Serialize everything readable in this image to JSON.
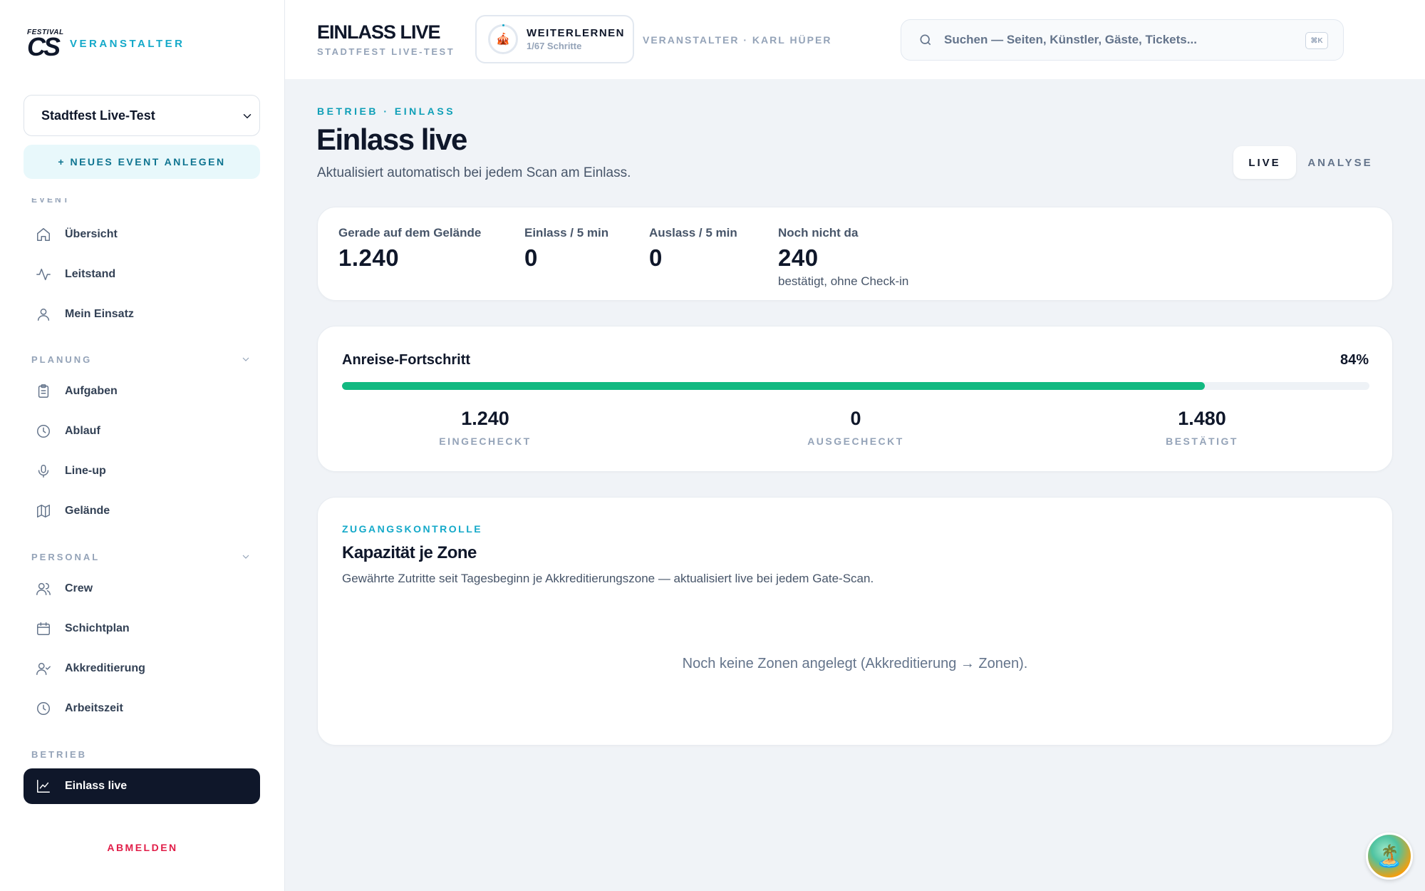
{
  "brand": {
    "logo_small": "FESTIVAL",
    "logo_big": "CS",
    "label": "VERANSTALTER"
  },
  "sidebar": {
    "event_select": "Stadtfest Live-Test",
    "new_event": "+ NEUES EVENT ANLEGEN",
    "cut_section": "EVENT",
    "items_event": [
      {
        "label": "Übersicht",
        "icon": "home-icon"
      },
      {
        "label": "Leitstand",
        "icon": "activity-icon"
      },
      {
        "label": "Mein Einsatz",
        "icon": "user-icon"
      }
    ],
    "section_planung": "PLANUNG",
    "items_planung": [
      {
        "label": "Aufgaben",
        "icon": "clipboard-icon"
      },
      {
        "label": "Ablauf",
        "icon": "clock-icon"
      },
      {
        "label": "Line-up",
        "icon": "microphone-icon"
      },
      {
        "label": "Gelände",
        "icon": "map-icon"
      }
    ],
    "section_personal": "PERSONAL",
    "items_personal": [
      {
        "label": "Crew",
        "icon": "users-icon"
      },
      {
        "label": "Schichtplan",
        "icon": "calendar-icon"
      },
      {
        "label": "Akkreditierung",
        "icon": "user-check-icon"
      },
      {
        "label": "Arbeitszeit",
        "icon": "clock-icon"
      }
    ],
    "section_betrieb": "BETRIEB",
    "items_betrieb": [
      {
        "label": "Einlass live",
        "icon": "chart-line-icon",
        "active": true
      }
    ],
    "logout": "ABMELDEN"
  },
  "header": {
    "title": "EINLASS LIVE",
    "subtitle": "STADTFEST LIVE-TEST",
    "learn_title": "WEITERLERNEN",
    "learn_progress": "1/67 Schritte",
    "user": "VERANSTALTER · KARL HÜPER",
    "search_placeholder": "Suchen — Seiten, Künstler, Gäste, Tickets...",
    "search_shortcut": "⌘K"
  },
  "main": {
    "breadcrumb": "BETRIEB · EINLASS",
    "title": "Einlass live",
    "subtitle": "Aktualisiert automatisch bei jedem Scan am Einlass.",
    "tabs": {
      "live": "LIVE",
      "analyse": "ANALYSE"
    },
    "kpis": [
      {
        "label": "Gerade auf dem Gelände",
        "value": "1.240"
      },
      {
        "label": "Einlass / 5 min",
        "value": "0"
      },
      {
        "label": "Auslass / 5 min",
        "value": "0"
      },
      {
        "label": "Noch nicht da",
        "value": "240",
        "note": "bestätigt, ohne Check-in"
      }
    ],
    "progress": {
      "title": "Anreise-Fortschritt",
      "percent_label": "84%",
      "fraction": 0.84,
      "stats": [
        {
          "value": "1.240",
          "label": "EINGECHECKT"
        },
        {
          "value": "0",
          "label": "AUSGECHECKT"
        },
        {
          "value": "1.480",
          "label": "BESTÄTIGT"
        }
      ]
    },
    "zones": {
      "eyebrow": "ZUGANGSKONTROLLE",
      "title": "Kapazität je Zone",
      "description": "Gewährte Zutritte seit Tagesbeginn je Akkreditierungszone — aktualisiert live bei jedem Gate-Scan.",
      "empty": "Noch keine Zonen angelegt (Akkreditierung → Zonen)."
    }
  },
  "colors": {
    "accent": "#14a9c9",
    "progress": "#12b981",
    "active_nav": "#0f172a",
    "logout": "#e11d48"
  }
}
